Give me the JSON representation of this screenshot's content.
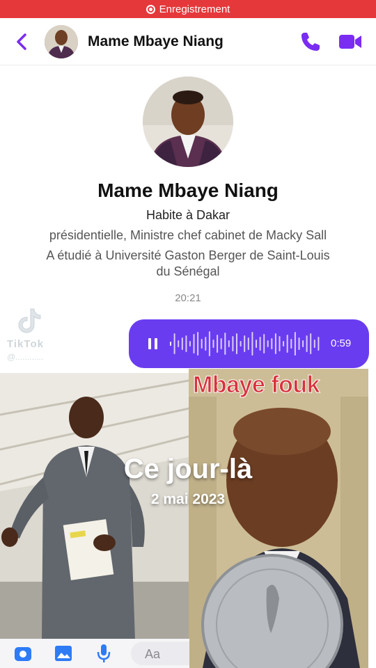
{
  "recording": {
    "label": "Enregistrement",
    "color": "#e5383b"
  },
  "header": {
    "name": "Mame Mbaye Niang",
    "back_icon": "chevron-left-icon",
    "call_icon": "phone-icon",
    "video_icon": "video-camera-icon",
    "accent": "#7a2cf2"
  },
  "profile": {
    "name": "Mame Mbaye Niang",
    "lives": "Habite à Dakar",
    "work": "présidentielle, Ministre chef cabinet de Macky Sall",
    "study_line1": "A étudié à Université Gaston Berger de Saint-Louis",
    "study_line2": "du Sénégal"
  },
  "timestamp": "20:21",
  "watermark": {
    "brand": "TikTok",
    "handle": "@............"
  },
  "voice_message": {
    "duration": "0:59",
    "bubble_color": "#6a3cf0"
  },
  "overlay": {
    "headline": "Ce jour-là",
    "date": "2 mai 2023",
    "right_image_caption": "Mbaye fouk"
  },
  "composer": {
    "placeholder": "Aa",
    "icons": [
      "camera-icon",
      "image-icon",
      "microphone-icon"
    ]
  }
}
